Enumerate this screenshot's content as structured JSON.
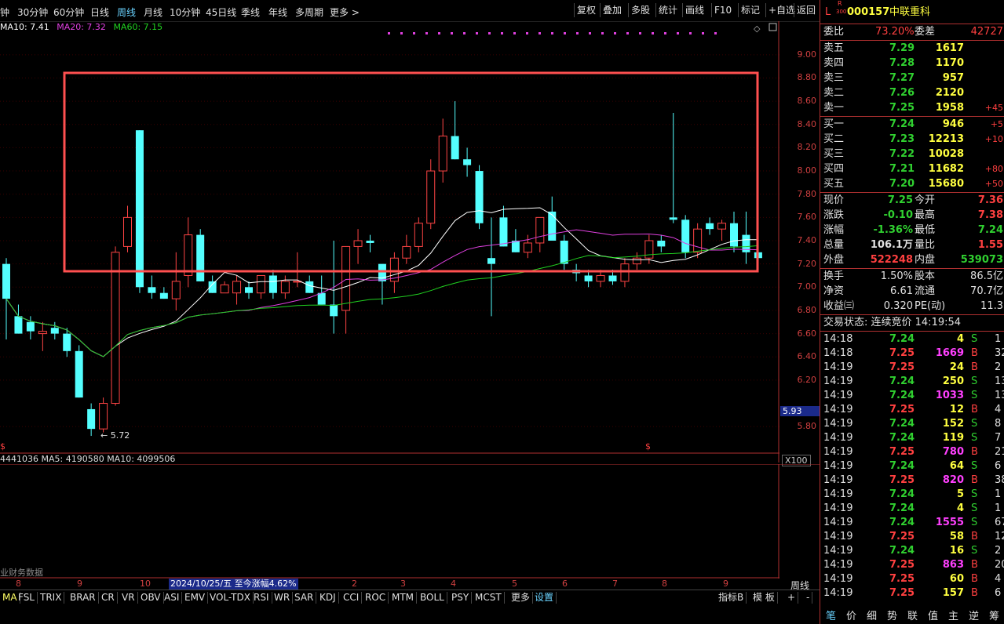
{
  "topbar": {
    "tabs": [
      {
        "label": "钟",
        "active": false
      },
      {
        "label": "30分钟",
        "active": false
      },
      {
        "label": "60分钟",
        "active": false
      },
      {
        "label": "日线",
        "active": false
      },
      {
        "label": "周线",
        "active": true
      },
      {
        "label": "月线",
        "active": false
      },
      {
        "label": "10分钟",
        "active": false
      },
      {
        "label": "45日线",
        "active": false
      },
      {
        "label": "季线",
        "active": false
      },
      {
        "label": "年线",
        "active": false
      },
      {
        "label": "多周期",
        "active": false
      },
      {
        "label": "更多 >",
        "active": false
      }
    ],
    "right_buttons": [
      "复权",
      "叠加",
      "多股",
      "统计",
      "画线",
      "F10",
      "标记",
      "+自选",
      "返回"
    ]
  },
  "ma_legend": {
    "ma10": "MA10: 7.41",
    "ma20": "MA20: 7.32",
    "ma60": "MA60: 7.15"
  },
  "colors": {
    "up": "#ff4444",
    "down": "#54ffff",
    "ma10": "#ffffff",
    "ma20": "#e040e0",
    "ma60": "#20d020",
    "highlight_box": "#ff5050"
  },
  "price_axis": [
    "9.00",
    "8.80",
    "8.60",
    "8.40",
    "8.20",
    "8.00",
    "7.80",
    "7.60",
    "7.40",
    "7.20",
    "7.00",
    "6.80",
    "6.60",
    "6.40",
    "6.20",
    "5.80"
  ],
  "price_current": "5.93",
  "low_marker": "5.72",
  "volume_legend": "4441036 MA5: 4190580 MA10: 4099506",
  "volume_scale": "X100",
  "finance_label": "业财务数据",
  "x_axis": [
    "8",
    "9",
    "10",
    "2",
    "3",
    "4",
    "5",
    "6",
    "7",
    "8",
    "9"
  ],
  "date_box": "2024/10/25/五  至今涨幅4.62%",
  "period_label": "周线",
  "indicators": [
    "MA",
    "FSL",
    "TRIX",
    "BRAR",
    "CR",
    "VR",
    "OBV",
    "ASI",
    "EMV",
    "VOL-TDX",
    "RSI",
    "WR",
    "SAR",
    "KDJ",
    "CCI",
    "ROC",
    "MTM",
    "BOLL",
    "PSY",
    "MCST"
  ],
  "ind_more": "更多",
  "ind_settings": "设置",
  "ind_right": [
    "指标B",
    "模 板",
    "+",
    "-"
  ],
  "chart_data": {
    "type": "candlestick",
    "ma_series": [
      {
        "name": "MA10",
        "value": 7.41
      },
      {
        "name": "MA20",
        "value": 7.32
      },
      {
        "name": "MA60",
        "value": 7.15
      }
    ],
    "ylim": [
      5.7,
      9.1
    ],
    "y_ticks": [
      9.0,
      8.8,
      8.6,
      8.4,
      8.2,
      8.0,
      7.8,
      7.6,
      7.4,
      7.2,
      7.0,
      6.8,
      6.6,
      6.4,
      6.2,
      5.8
    ],
    "candles": [
      {
        "o": 7.2,
        "h": 7.25,
        "l": 6.55,
        "c": 6.9
      },
      {
        "o": 6.75,
        "h": 6.85,
        "l": 6.6,
        "c": 6.6
      },
      {
        "o": 6.7,
        "h": 6.75,
        "l": 6.55,
        "c": 6.62
      },
      {
        "o": 6.6,
        "h": 6.7,
        "l": 6.45,
        "c": 6.62
      },
      {
        "o": 6.65,
        "h": 6.7,
        "l": 6.55,
        "c": 6.6
      },
      {
        "o": 6.6,
        "h": 6.65,
        "l": 6.4,
        "c": 6.45
      },
      {
        "o": 6.45,
        "h": 6.5,
        "l": 6.05,
        "c": 6.05
      },
      {
        "o": 5.95,
        "h": 6.0,
        "l": 5.72,
        "c": 5.78
      },
      {
        "o": 5.78,
        "h": 6.05,
        "l": 5.75,
        "c": 6.0
      },
      {
        "o": 6.0,
        "h": 7.35,
        "l": 5.98,
        "c": 7.3
      },
      {
        "o": 7.35,
        "h": 7.7,
        "l": 7.3,
        "c": 7.6
      },
      {
        "o": 8.35,
        "h": 8.35,
        "l": 6.95,
        "c": 7.0
      },
      {
        "o": 7.0,
        "h": 7.1,
        "l": 6.9,
        "c": 6.95
      },
      {
        "o": 6.95,
        "h": 7.0,
        "l": 6.9,
        "c": 6.9
      },
      {
        "o": 6.9,
        "h": 7.3,
        "l": 6.8,
        "c": 7.05
      },
      {
        "o": 7.1,
        "h": 7.6,
        "l": 7.0,
        "c": 7.45
      },
      {
        "o": 7.45,
        "h": 7.5,
        "l": 7.05,
        "c": 7.05
      },
      {
        "o": 7.05,
        "h": 7.1,
        "l": 6.95,
        "c": 6.95
      },
      {
        "o": 6.95,
        "h": 7.05,
        "l": 6.95,
        "c": 7.02
      },
      {
        "o": 6.95,
        "h": 7.1,
        "l": 6.85,
        "c": 7.05
      },
      {
        "o": 7.0,
        "h": 7.05,
        "l": 6.9,
        "c": 6.95
      },
      {
        "o": 6.95,
        "h": 7.1,
        "l": 6.9,
        "c": 7.1
      },
      {
        "o": 7.1,
        "h": 7.15,
        "l": 6.9,
        "c": 6.95
      },
      {
        "o": 6.95,
        "h": 7.1,
        "l": 6.9,
        "c": 7.05
      },
      {
        "o": 7.05,
        "h": 7.3,
        "l": 7.0,
        "c": 7.05
      },
      {
        "o": 7.05,
        "h": 7.1,
        "l": 6.95,
        "c": 6.95
      },
      {
        "o": 6.95,
        "h": 7.1,
        "l": 6.85,
        "c": 6.85
      },
      {
        "o": 6.85,
        "h": 7.4,
        "l": 6.6,
        "c": 6.75
      },
      {
        "o": 6.8,
        "h": 7.3,
        "l": 6.6,
        "c": 7.35
      },
      {
        "o": 7.35,
        "h": 7.5,
        "l": 7.2,
        "c": 7.4
      },
      {
        "o": 7.4,
        "h": 7.45,
        "l": 7.3,
        "c": 7.38
      },
      {
        "o": 7.2,
        "h": 7.2,
        "l": 6.85,
        "c": 7.05
      },
      {
        "o": 7.05,
        "h": 7.3,
        "l": 6.95,
        "c": 7.25
      },
      {
        "o": 7.25,
        "h": 7.45,
        "l": 7.2,
        "c": 7.35
      },
      {
        "o": 7.35,
        "h": 7.6,
        "l": 7.3,
        "c": 7.55
      },
      {
        "o": 7.55,
        "h": 8.1,
        "l": 7.5,
        "c": 8.0
      },
      {
        "o": 8.0,
        "h": 8.45,
        "l": 7.9,
        "c": 8.3
      },
      {
        "o": 8.3,
        "h": 8.6,
        "l": 8.1,
        "c": 8.1
      },
      {
        "o": 8.1,
        "h": 8.2,
        "l": 7.95,
        "c": 8.05
      },
      {
        "o": 8.0,
        "h": 8.05,
        "l": 7.5,
        "c": 7.55
      },
      {
        "o": 7.25,
        "h": 7.6,
        "l": 6.75,
        "c": 7.2
      },
      {
        "o": 7.6,
        "h": 7.7,
        "l": 7.35,
        "c": 7.35
      },
      {
        "o": 7.4,
        "h": 7.5,
        "l": 7.3,
        "c": 7.3
      },
      {
        "o": 7.3,
        "h": 7.45,
        "l": 7.25,
        "c": 7.38
      },
      {
        "o": 7.38,
        "h": 7.6,
        "l": 7.3,
        "c": 7.6
      },
      {
        "o": 7.65,
        "h": 7.78,
        "l": 7.4,
        "c": 7.4
      },
      {
        "o": 7.4,
        "h": 7.45,
        "l": 7.15,
        "c": 7.2
      },
      {
        "o": 7.15,
        "h": 7.2,
        "l": 7.05,
        "c": 7.12
      },
      {
        "o": 7.1,
        "h": 7.15,
        "l": 7.0,
        "c": 7.05
      },
      {
        "o": 7.05,
        "h": 7.15,
        "l": 7.0,
        "c": 7.1
      },
      {
        "o": 7.1,
        "h": 7.15,
        "l": 7.02,
        "c": 7.05
      },
      {
        "o": 7.05,
        "h": 7.25,
        "l": 7.0,
        "c": 7.2
      },
      {
        "o": 7.2,
        "h": 7.3,
        "l": 7.15,
        "c": 7.25
      },
      {
        "o": 7.25,
        "h": 7.45,
        "l": 7.2,
        "c": 7.4
      },
      {
        "o": 7.4,
        "h": 7.45,
        "l": 7.3,
        "c": 7.35
      },
      {
        "o": 7.6,
        "h": 8.5,
        "l": 7.55,
        "c": 7.58
      },
      {
        "o": 7.58,
        "h": 7.62,
        "l": 7.25,
        "c": 7.3
      },
      {
        "o": 7.3,
        "h": 7.55,
        "l": 7.25,
        "c": 7.5
      },
      {
        "o": 7.55,
        "h": 7.6,
        "l": 7.45,
        "c": 7.5
      },
      {
        "o": 7.5,
        "h": 7.58,
        "l": 7.4,
        "c": 7.55
      },
      {
        "o": 7.55,
        "h": 7.65,
        "l": 7.3,
        "c": 7.35
      },
      {
        "o": 7.45,
        "h": 7.65,
        "l": 7.2,
        "c": 7.3
      },
      {
        "o": 7.3,
        "h": 7.38,
        "l": 7.24,
        "c": 7.25
      }
    ]
  },
  "quote": {
    "code": "000157",
    "name": "中联重科",
    "prefix": "L",
    "tag_top": "R",
    "tag_bottom": "300",
    "weibi_label": "委比",
    "weibi": "73.20%",
    "weicha_label": "委差",
    "weicha": "42727",
    "asks": [
      {
        "label": "卖五",
        "price": "7.29",
        "vol": "1617",
        "chg": ""
      },
      {
        "label": "卖四",
        "price": "7.28",
        "vol": "1170",
        "chg": ""
      },
      {
        "label": "卖三",
        "price": "7.27",
        "vol": "957",
        "chg": ""
      },
      {
        "label": "卖二",
        "price": "7.26",
        "vol": "2120",
        "chg": ""
      },
      {
        "label": "卖一",
        "price": "7.25",
        "vol": "1958",
        "chg": "+45"
      }
    ],
    "bids": [
      {
        "label": "买一",
        "price": "7.24",
        "vol": "946",
        "chg": "+5"
      },
      {
        "label": "买二",
        "price": "7.23",
        "vol": "12213",
        "chg": "+10"
      },
      {
        "label": "买三",
        "price": "7.22",
        "vol": "10028",
        "chg": ""
      },
      {
        "label": "买四",
        "price": "7.21",
        "vol": "11682",
        "chg": "+80"
      },
      {
        "label": "买五",
        "price": "7.20",
        "vol": "15680",
        "chg": "+50"
      }
    ],
    "stats": [
      {
        "l1": "现价",
        "v1": "7.25",
        "c1": "grn",
        "l2": "今开",
        "v2": "7.36",
        "c2": "red"
      },
      {
        "l1": "涨跌",
        "v1": "-0.10",
        "c1": "grn",
        "l2": "最高",
        "v2": "7.38",
        "c2": "red"
      },
      {
        "l1": "涨幅",
        "v1": "-1.36%",
        "c1": "grn",
        "l2": "最低",
        "v2": "7.24",
        "c2": "grn"
      },
      {
        "l1": "总量",
        "v1": "106.1万",
        "c1": "wht",
        "l2": "量比",
        "v2": "1.55",
        "c2": "red"
      },
      {
        "l1": "外盘",
        "v1": "522248",
        "c1": "red",
        "l2": "内盘",
        "v2": "539073",
        "c2": "grn"
      }
    ],
    "stats2": [
      {
        "l1": "换手",
        "v1": "1.50%",
        "l2": "股本",
        "v2": "86.5亿"
      },
      {
        "l1": "净资",
        "v1": "6.61",
        "l2": "流通",
        "v2": "70.7亿"
      },
      {
        "l1": "收益㈢",
        "v1": "0.320",
        "l2": "PE(动)",
        "v2": "11.3"
      }
    ],
    "trade_status": "交易状态: 连续竞价 14:19:54",
    "ticks": [
      {
        "t": "14:18",
        "p": "7.24",
        "v": "4",
        "s": "S",
        "n": "1",
        "vc": "yel"
      },
      {
        "t": "14:18",
        "p": "7.25",
        "v": "1669",
        "s": "B",
        "n": "32",
        "vc": "mag"
      },
      {
        "t": "14:19",
        "p": "7.25",
        "v": "24",
        "s": "B",
        "n": "2",
        "vc": "yel"
      },
      {
        "t": "14:19",
        "p": "7.24",
        "v": "250",
        "s": "S",
        "n": "13",
        "vc": "yel"
      },
      {
        "t": "14:19",
        "p": "7.24",
        "v": "1033",
        "s": "S",
        "n": "13",
        "vc": "mag"
      },
      {
        "t": "14:19",
        "p": "7.25",
        "v": "12",
        "s": "B",
        "n": "4",
        "vc": "yel"
      },
      {
        "t": "14:19",
        "p": "7.24",
        "v": "152",
        "s": "S",
        "n": "8",
        "vc": "yel"
      },
      {
        "t": "14:19",
        "p": "7.24",
        "v": "119",
        "s": "S",
        "n": "7",
        "vc": "yel"
      },
      {
        "t": "14:19",
        "p": "7.25",
        "v": "780",
        "s": "B",
        "n": "21",
        "vc": "mag"
      },
      {
        "t": "14:19",
        "p": "7.24",
        "v": "64",
        "s": "S",
        "n": "6",
        "vc": "yel"
      },
      {
        "t": "14:19",
        "p": "7.25",
        "v": "820",
        "s": "B",
        "n": "38",
        "vc": "mag"
      },
      {
        "t": "14:19",
        "p": "7.24",
        "v": "5",
        "s": "S",
        "n": "1",
        "vc": "yel"
      },
      {
        "t": "14:19",
        "p": "7.24",
        "v": "4",
        "s": "S",
        "n": "1",
        "vc": "yel"
      },
      {
        "t": "14:19",
        "p": "7.24",
        "v": "1555",
        "s": "S",
        "n": "67",
        "vc": "mag"
      },
      {
        "t": "14:19",
        "p": "7.25",
        "v": "58",
        "s": "B",
        "n": "12",
        "vc": "yel"
      },
      {
        "t": "14:19",
        "p": "7.24",
        "v": "16",
        "s": "S",
        "n": "2",
        "vc": "yel"
      },
      {
        "t": "14:19",
        "p": "7.25",
        "v": "863",
        "s": "B",
        "n": "20",
        "vc": "mag"
      },
      {
        "t": "14:19",
        "p": "7.25",
        "v": "60",
        "s": "B",
        "n": "4",
        "vc": "yel"
      },
      {
        "t": "14:19",
        "p": "7.25",
        "v": "157",
        "s": "B",
        "n": "6",
        "vc": "yel"
      }
    ],
    "bottom_tabs": [
      "笔",
      "价",
      "细",
      "势",
      "联",
      "值",
      "主",
      "逆",
      "筹"
    ]
  }
}
